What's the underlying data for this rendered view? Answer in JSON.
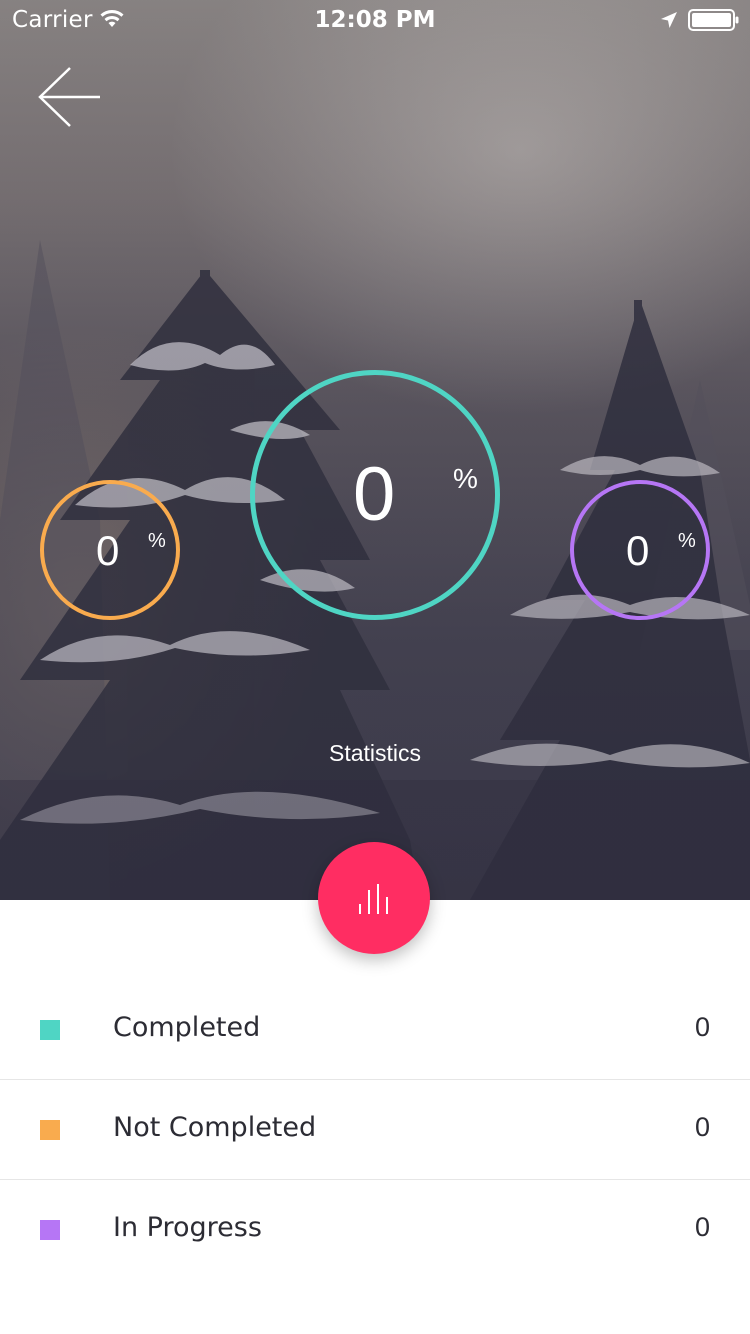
{
  "status_bar": {
    "carrier": "Carrier",
    "time": "12:08 PM",
    "icons": [
      "wifi-icon",
      "location-arrow-icon",
      "battery-icon"
    ]
  },
  "header": {
    "back_icon": "arrow-left-icon"
  },
  "rings": {
    "completed": {
      "value": "0",
      "unit": "%",
      "color": "#4fd5c4",
      "progress": 0
    },
    "not_completed": {
      "value": "0",
      "unit": "%",
      "color": "#f9ab4e",
      "progress": 0
    },
    "in_progress": {
      "value": "0",
      "unit": "%",
      "color": "#b676f5",
      "progress": 0
    }
  },
  "statistics_label": "Statistics",
  "fab": {
    "icon": "bar-chart-icon",
    "color": "#ff2d62"
  },
  "legend": [
    {
      "label": "Completed",
      "count": "0",
      "color": "#4fd5c4"
    },
    {
      "label": "Not Completed",
      "count": "0",
      "color": "#f9ab4e"
    },
    {
      "label": "In Progress",
      "count": "0",
      "color": "#b676f5"
    }
  ]
}
